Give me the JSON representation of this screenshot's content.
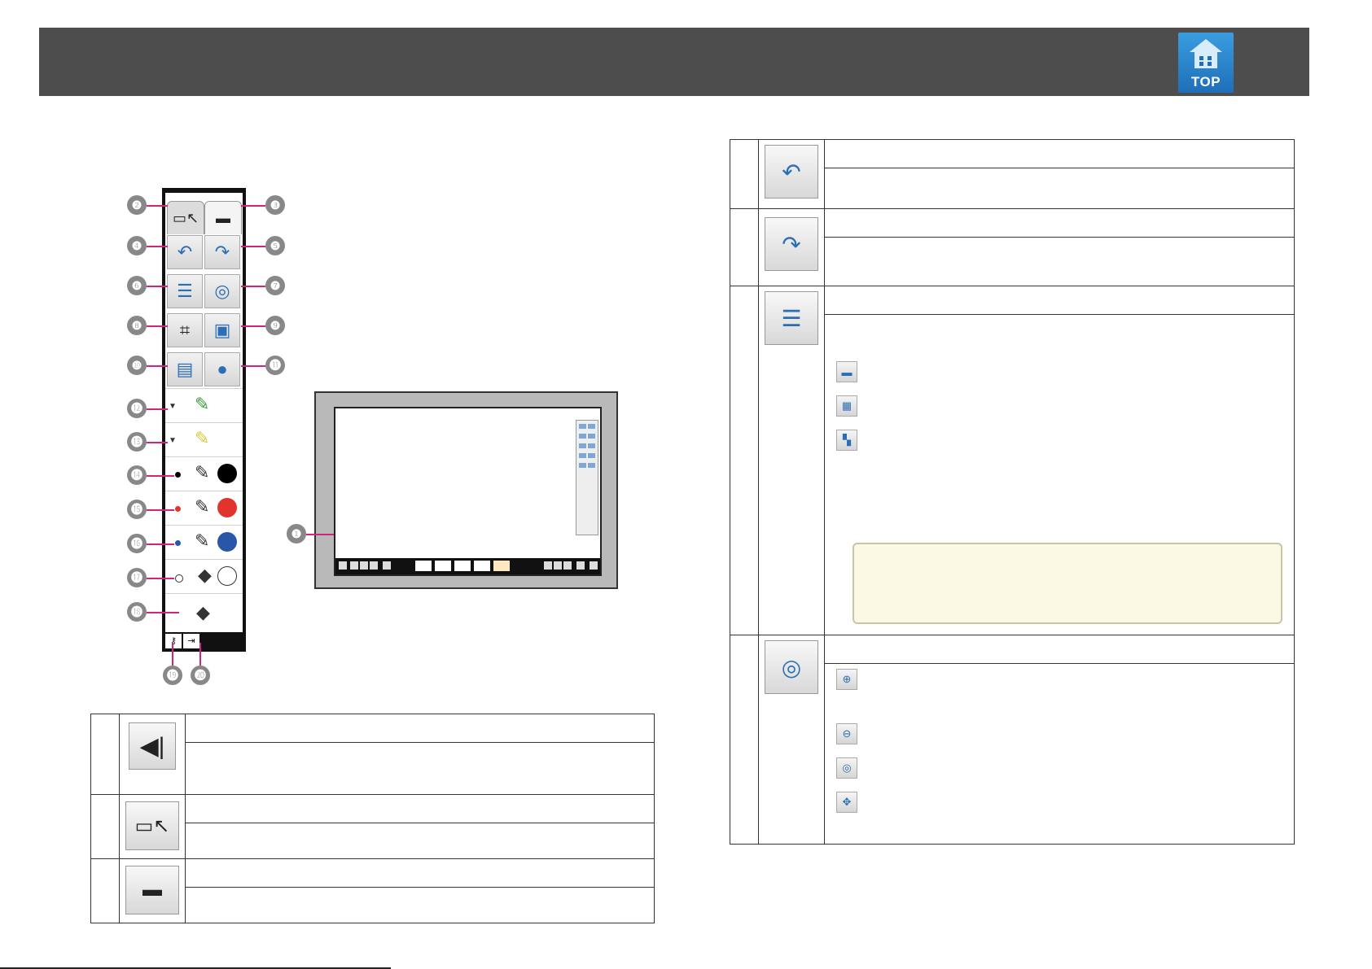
{
  "header": {
    "top_button_label": "TOP"
  },
  "toolbar_figure": {
    "callouts": [
      "❷",
      "❸",
      "❹",
      "❺",
      "❻",
      "❼",
      "❽",
      "❾",
      "❿",
      "⓫",
      "⓬",
      "⓭",
      "⓮",
      "⓯",
      "⓰",
      "⓱",
      "⓲",
      "⓳",
      "⓴"
    ],
    "colors": {
      "black": "#000000",
      "red": "#e0342c",
      "blue": "#2856a8",
      "white": "#ffffff",
      "green_marker": "#3a9a3a",
      "yellow_marker": "#f0e34a"
    },
    "icons": [
      "pointer-mode-tab-icon",
      "whiteboard-mode-tab-icon",
      "undo-icon",
      "redo-icon",
      "layout-icon",
      "zoom-icon",
      "crop-icon",
      "image-insert-icon",
      "capture-icon",
      "shapes-icon",
      "marker-green-icon",
      "marker-yellow-icon",
      "pen-black-icon",
      "pen-red-icon",
      "pen-blue-icon",
      "eraser-icon",
      "clear-all-icon",
      "settings-icon",
      "exit-icon"
    ]
  },
  "screen_figure": {
    "callout": "❶"
  },
  "left_table": {
    "rows": [
      {
        "icon": "collapse-toolbar-icon"
      },
      {
        "icon": "pointer-mode-tab-icon"
      },
      {
        "icon": "whiteboard-mode-tab-icon"
      }
    ]
  },
  "right_table": {
    "rows": [
      {
        "icon": "undo-icon"
      },
      {
        "icon": "redo-icon"
      },
      {
        "icon": "layout-icon",
        "sub_icons": [
          "single-page-icon",
          "grid-page-icon",
          "multi-page-icon"
        ]
      },
      {
        "icon": "zoom-icon",
        "sub_icons": [
          "zoom-in-icon",
          "zoom-out-icon",
          "zoom-reset-icon",
          "pan-icon"
        ]
      }
    ]
  }
}
